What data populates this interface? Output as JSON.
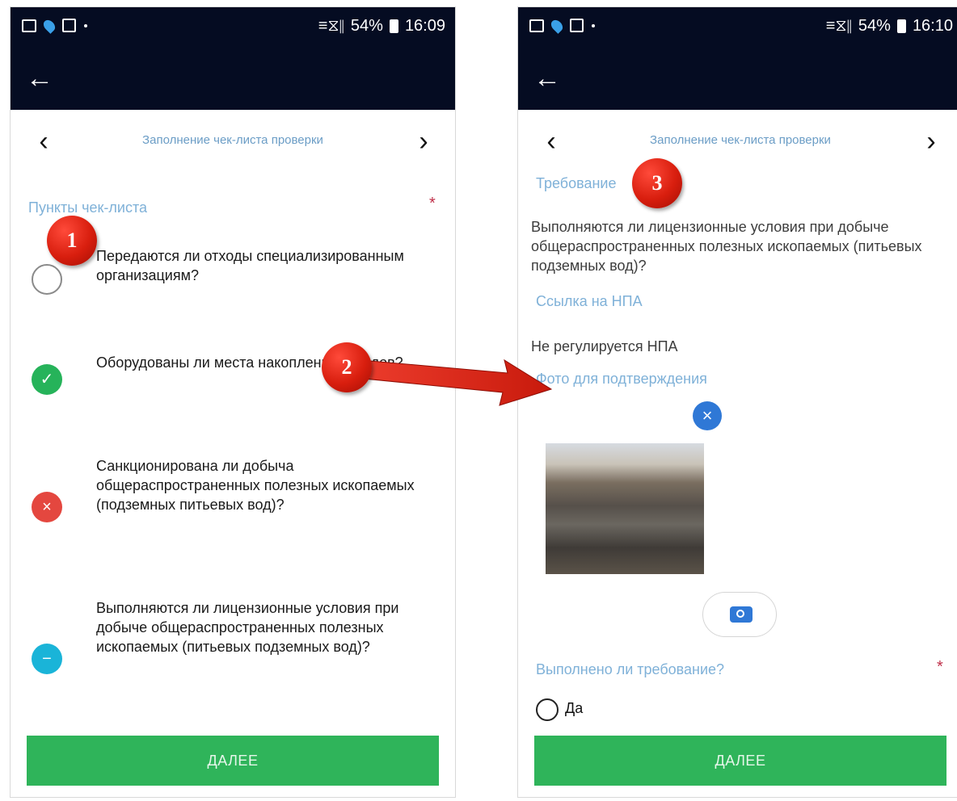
{
  "left": {
    "statusbar": {
      "signal": "≡⧖∥",
      "battery_pct": "54%",
      "time": "16:09"
    },
    "nav": {
      "title": "Заполнение чек-листа проверки",
      "prev_icon": "chevron-left-icon",
      "next_icon": "chevron-right-icon"
    },
    "section_label": "Пункты чек-листа",
    "required_mark": "*",
    "items": [
      {
        "text": "Передаются ли отходы специализированным организациям?",
        "status": "empty"
      },
      {
        "text": "Оборудованы ли места накопления отходов?",
        "status": "ok",
        "symbol": "✓"
      },
      {
        "text": "Санкционирована ли добыча общераспространенных полезных ископаемых (подземных питьевых вод)?",
        "status": "no",
        "symbol": "×"
      },
      {
        "text": "Выполняются ли лицензионные условия при добыче общераспространенных полезных ископаемых (питьевых подземных вод)?",
        "status": "na",
        "symbol": "−"
      }
    ],
    "next_button": "ДАЛЕЕ"
  },
  "right": {
    "statusbar": {
      "signal": "≡⧖∥",
      "battery_pct": "54%",
      "time": "16:10"
    },
    "nav": {
      "title": "Заполнение чек-листа проверки"
    },
    "requirement_label": "Требование",
    "requirement_text": "Выполняются ли лицензионные условия при добыче общераспространенных полезных ископаемых (питьевых подземных вод)?",
    "npa_label": "Ссылка на НПА",
    "npa_text": "Не регулируется НПА",
    "photo_label": "Фото для подтверждения",
    "photo_close_symbol": "×",
    "camera_icon": "camera-icon",
    "question_label": "Выполнено ли требование?",
    "required_mark": "*",
    "radio_yes": "Да",
    "next_button": "ДАЛЕЕ"
  },
  "annotations": {
    "badge1": "1",
    "badge2": "2",
    "badge3": "3"
  },
  "colors": {
    "header": "#050c22",
    "accent_label": "#7fb1d8",
    "green": "#2fb45a",
    "ok": "#26b35a",
    "no": "#e4473f",
    "na": "#1ab4d8",
    "badge_red": "#d81e0e"
  }
}
